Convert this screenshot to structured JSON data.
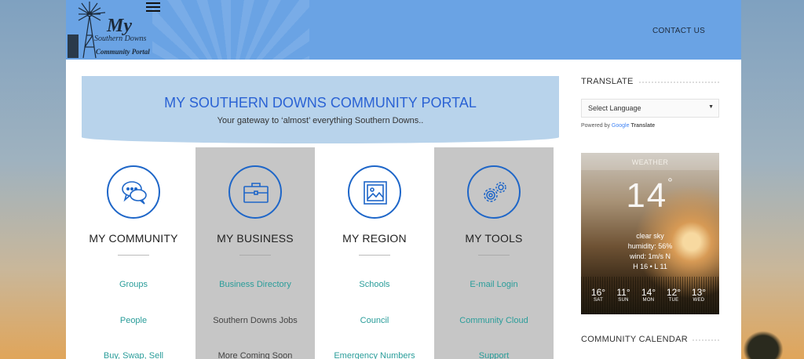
{
  "header": {
    "logo": {
      "my": "My",
      "southern_downs": "Southern Downs",
      "community_portal": "Community Portal"
    },
    "nav": {
      "contact": "CONTACT US"
    },
    "menu_icon": "hamburger-icon"
  },
  "hero": {
    "title": "MY SOUTHERN DOWNS COMMUNITY PORTAL",
    "subtitle": "Your gateway to ‘almost’ everything Southern Downs.."
  },
  "columns": [
    {
      "title": "MY COMMUNITY",
      "icon": "chat-bubbles-icon",
      "links": [
        "Groups",
        "People",
        "Buy, Swap, Sell"
      ]
    },
    {
      "title": "MY BUSINESS",
      "icon": "briefcase-icon",
      "links": [
        "Business Directory",
        "Southern Downs Jobs",
        "More Coming Soon"
      ]
    },
    {
      "title": "MY REGION",
      "icon": "picture-icon",
      "links": [
        "Schools",
        "Council",
        "Emergency Numbers"
      ]
    },
    {
      "title": "MY TOOLS",
      "icon": "gears-icon",
      "links": [
        "E-mail Login",
        "Community Cloud",
        "Support"
      ]
    }
  ],
  "sidebar": {
    "translate": {
      "heading": "TRANSLATE",
      "select_value": "Select Language",
      "powered_by": "Powered by",
      "google": "Google",
      "translate_word": "Translate"
    },
    "weather": {
      "label": "WEATHER",
      "temp": "14",
      "deg": "°",
      "condition": "clear sky",
      "humidity": "humidity: 56%",
      "wind": "wind: 1m/s N",
      "hilo": "H 16 • L 11",
      "forecast": [
        {
          "temp": "16°",
          "day": "SAT"
        },
        {
          "temp": "11°",
          "day": "SUN"
        },
        {
          "temp": "14°",
          "day": "MON"
        },
        {
          "temp": "12°",
          "day": "TUE"
        },
        {
          "temp": "13°",
          "day": "WED"
        }
      ]
    },
    "calendar": {
      "heading": "COMMUNITY CALENDAR"
    }
  },
  "colors": {
    "header_bg": "#6aa3e4",
    "hero_bg": "#b8d3eb",
    "hero_title": "#2a62d4",
    "icon_ring": "#1e66c8",
    "link": "#2a9d9a",
    "grey_column": "#c6c6c6"
  }
}
